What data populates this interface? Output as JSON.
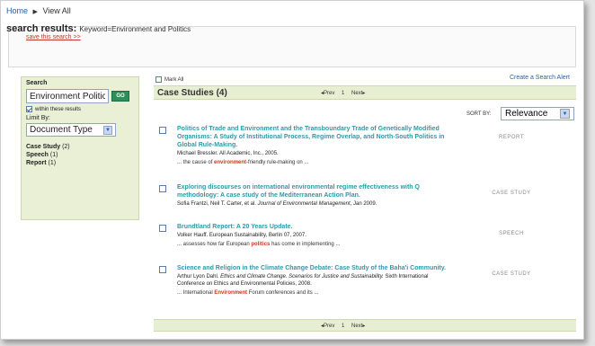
{
  "breadcrumb": {
    "home": "Home",
    "separator": "▶",
    "current": "View All"
  },
  "header": {
    "title": "search results:",
    "keyword_text": "Keyword=Environment and Politics",
    "save_link": "save this search >>"
  },
  "sidebar": {
    "search_label": "Search",
    "search_value": "Environment Politics",
    "go_label": "GO",
    "within_label": "within these results",
    "within_checked": true,
    "limit_label": "Limit By:",
    "limit_value": "Document Type",
    "facets": [
      {
        "name": "Case Study",
        "count": "(2)"
      },
      {
        "name": "Speech",
        "count": "(1)"
      },
      {
        "name": "Report",
        "count": "(1)"
      }
    ]
  },
  "toolbar": {
    "mark_all": "Mark All",
    "create_alert": "Create a Search Alert",
    "category_title": "Case Studies (4)",
    "prev": "◂Prev",
    "page": "1",
    "next": "Next▸",
    "sort_label": "SORT BY:",
    "sort_value": "Relevance"
  },
  "results": [
    {
      "title": "Politics of Trade and Environment and the Transboundary Trade of Genetically Modified Organisms: A Study of Institutional Process, Regime Overlap, and North-South Politics in Global Rule-Making.",
      "meta": "Michael Bressler. All Academic, Inc., 2005.",
      "snippet_before": "... the cause of ",
      "snippet_hl": "environment",
      "snippet_after": "-friendly rule-making on ...",
      "type": "REPORT"
    },
    {
      "title": "Exploring discourses on international environmental regime effectiveness with Q methodology: A case study of the Mediterranean Action Plan.",
      "meta_before": "Sofia Frantzi, Neil T. Carter, et al. ",
      "meta_italic": "Journal of Environmental Management",
      "meta_after": ", Jan 2009.",
      "type": "CASE STUDY"
    },
    {
      "title": "Brundtland Report: A 20 Years Update.",
      "meta": "Volker Hauff. European Sustainability, Berlin 07, 2007.",
      "snippet_before": "... assesses how far European ",
      "snippet_hl": "politics",
      "snippet_after": " has come in implementing ...",
      "type": "SPEECH"
    },
    {
      "title": "Science and Religion in the Climate Change Debate: Case Study of the Baha'i Community.",
      "meta_before": "Arthur Lyon Dahl. ",
      "meta_italic": "Ethics and Climate Change. Scenarios for Justice and Sustainability.",
      "meta_after": " Sixth International Conference on Ethics and Environmental Policies, 2008.",
      "snippet_before": "... International ",
      "snippet_hl": "Environment",
      "snippet_after": " Forum conferences and its ...",
      "type": "CASE STUDY"
    }
  ]
}
